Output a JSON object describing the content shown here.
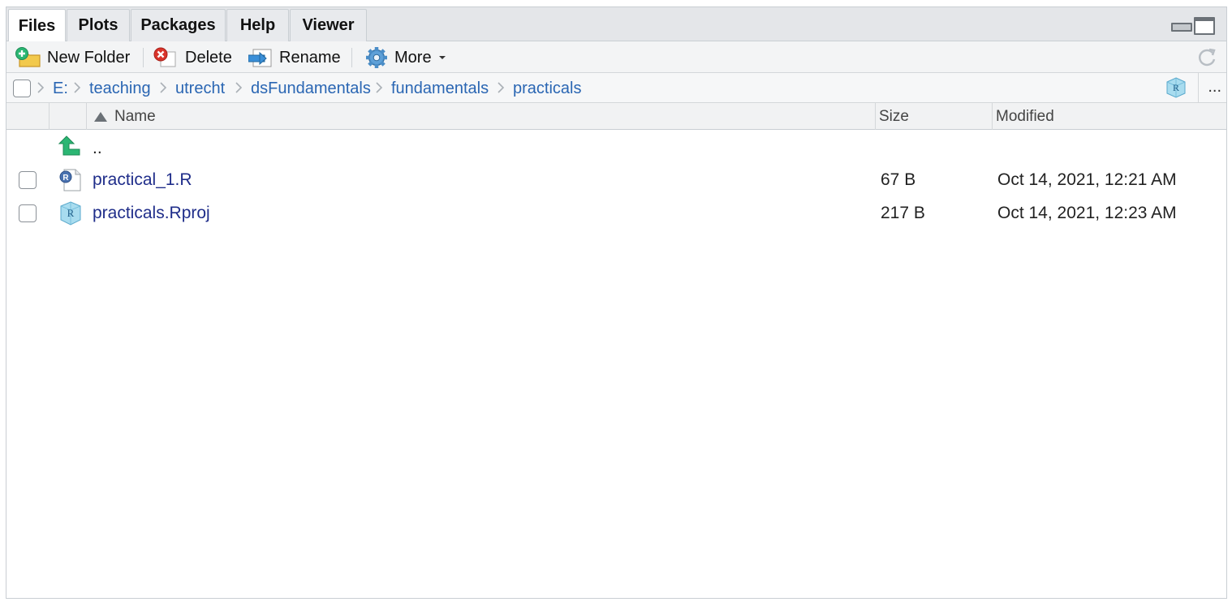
{
  "tabs": [
    {
      "label": "Files",
      "active": true
    },
    {
      "label": "Plots",
      "active": false
    },
    {
      "label": "Packages",
      "active": false
    },
    {
      "label": "Help",
      "active": false
    },
    {
      "label": "Viewer",
      "active": false
    }
  ],
  "toolbar": {
    "new_folder": "New Folder",
    "delete": "Delete",
    "rename": "Rename",
    "more": "More"
  },
  "breadcrumb": [
    "E:",
    "teaching",
    "utrecht",
    "dsFundamentals",
    "fundamentals",
    "practicals"
  ],
  "breadcrumb_more": "...",
  "columns": {
    "name": "Name",
    "size": "Size",
    "modified": "Modified"
  },
  "parent_dir": "..",
  "files": [
    {
      "name": "practical_1.R",
      "size": "67 B",
      "modified": "Oct 14, 2021, 12:21 AM",
      "icon": "r-script-icon"
    },
    {
      "name": "practicals.Rproj",
      "size": "217 B",
      "modified": "Oct 14, 2021, 12:23 AM",
      "icon": "rproj-icon"
    }
  ],
  "colors": {
    "link": "#2a66b3",
    "filename": "#1f2d8a",
    "up_arrow": "#2bb673"
  }
}
